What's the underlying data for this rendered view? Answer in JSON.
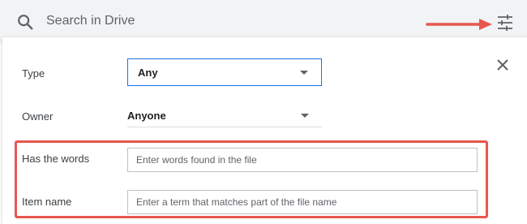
{
  "search": {
    "placeholder": "Search in Drive"
  },
  "annotation": {
    "arrow_color": "#e8574f",
    "highlight_color": "#e8574f"
  },
  "icons": {
    "search": "search-icon",
    "tune": "tune-icon",
    "close": "close-icon",
    "dropdown": "chevron-down-icon"
  },
  "form": {
    "type": {
      "label": "Type",
      "value": "Any"
    },
    "owner": {
      "label": "Owner",
      "value": "Anyone"
    },
    "has_words": {
      "label": "Has the words",
      "placeholder": "Enter words found in the file"
    },
    "item_name": {
      "label": "Item name",
      "placeholder": "Enter a term that matches part of the file name"
    }
  },
  "colors": {
    "focus_border": "#1a73e8",
    "searchbar_bg": "#f1f3f4"
  }
}
